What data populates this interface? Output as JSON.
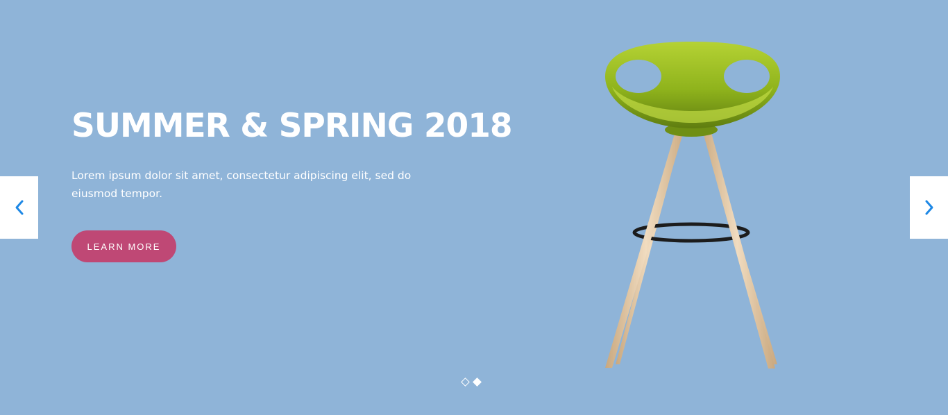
{
  "slide": {
    "headline": "SUMMER & SPRING 2018",
    "description": "Lorem ipsum dolor sit amet, consectetur adipiscing elit, sed do eiusmod tempor.",
    "cta_label": "LEARN MORE"
  },
  "colors": {
    "background": "#8fb4d8",
    "cta": "#bf4875",
    "arrow_icon": "#1e88e5",
    "seat": "#8fb31c",
    "legs": "#e4c9a6",
    "footrest": "#1c1c1c"
  },
  "navigation": {
    "prev_icon": "chevron-left-icon",
    "next_icon": "chevron-right-icon",
    "slide_count": 2,
    "active_slide": 2
  },
  "image": {
    "subject": "green-bar-stool"
  }
}
